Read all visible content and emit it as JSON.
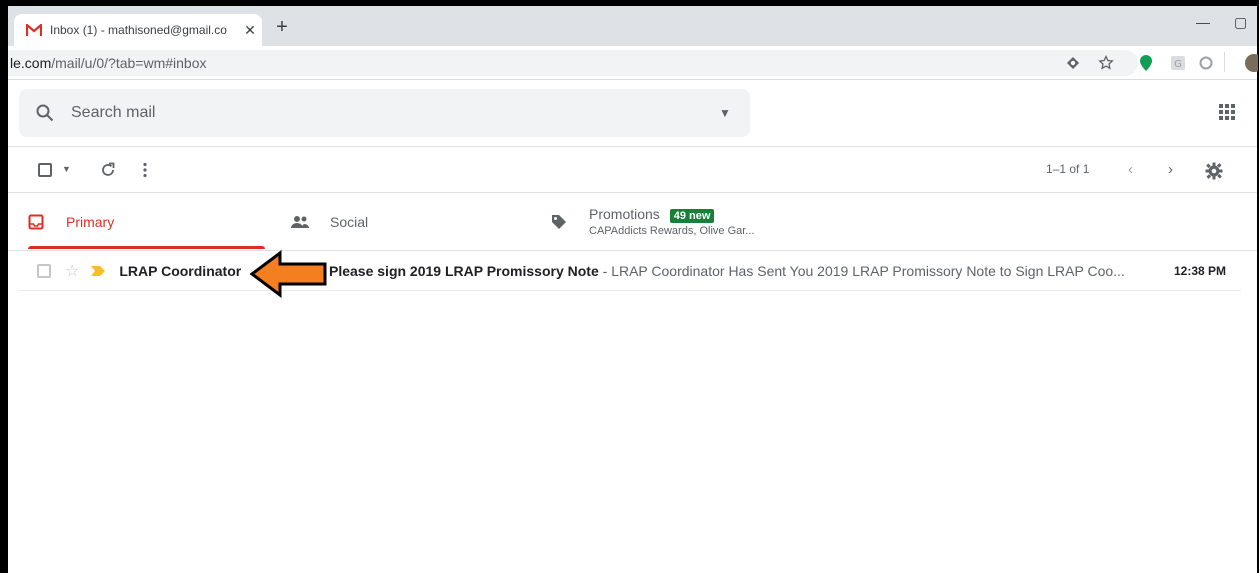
{
  "browser": {
    "tab_title": "Inbox (1) - mathisoned@gmail.co",
    "tab_close": "✕",
    "new_tab": "+",
    "minimize": "—",
    "maximize": "▢",
    "url_host": "le.com",
    "url_path": "/mail/u/0/?tab=wm#inbox"
  },
  "gmail": {
    "search_placeholder": "Search mail",
    "pager": "1–1 of 1",
    "categories": [
      {
        "label": "Primary"
      },
      {
        "label": "Social"
      },
      {
        "label": "Promotions",
        "badge": "49 new",
        "sub": "CAPAddicts Rewards, Olive Gar..."
      }
    ],
    "emails": [
      {
        "sender": "LRAP Coordinator",
        "subject": "Please sign 2019 LRAP Promissory Note",
        "snippet": " - LRAP Coordinator Has Sent You 2019 LRAP Promissory Note to Sign LRAP Coo...",
        "time": "12:38 PM"
      }
    ]
  },
  "colors": {
    "accent_red": "#d93025",
    "badge_green": "#188038",
    "arrow_orange": "#f47f20",
    "important_yellow": "#f6bf26"
  }
}
